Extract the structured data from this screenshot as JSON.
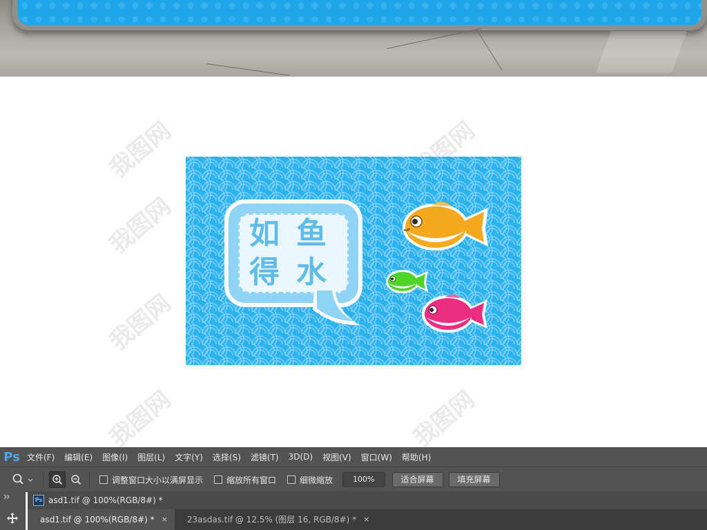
{
  "artwork": {
    "title_chars": [
      "如",
      "鱼",
      "得",
      "水"
    ],
    "colors": {
      "background": "#2db2ee",
      "bubble": "#8fd3f7",
      "title": "#5fbcea"
    },
    "fish": [
      {
        "name": "orange-fish",
        "color": "#f5a91e"
      },
      {
        "name": "green-fish",
        "color": "#4fd42a"
      },
      {
        "name": "pink-fish",
        "color": "#ec2d82"
      }
    ]
  },
  "watermark": "我图网",
  "menubar": {
    "logo": "Ps",
    "items": [
      "文件(F)",
      "编辑(E)",
      "图像(I)",
      "图层(L)",
      "文字(Y)",
      "选择(S)",
      "滤镜(T)",
      "3D(D)",
      "视图(V)",
      "窗口(W)",
      "帮助(H)"
    ]
  },
  "options": {
    "tool_icon": "zoom-icon",
    "checkbox_resize": "调整窗口大小以满屏显示",
    "checkbox_zoom_all": "缩放所有窗口",
    "checkbox_scrubby": "细微缩放",
    "zoom_value": "100%",
    "fit_screen": "适合屏幕",
    "fill_screen": "填充屏幕"
  },
  "panel_header": "asd1.tif @ 100%(RGB/8#) *",
  "tabs": [
    {
      "label": "asd1.tif @ 100%(RGB/8#) *",
      "active": true
    },
    {
      "label": "23asdas.tif @ 12.5% (图层 16, RGB/8#) *",
      "active": false
    }
  ],
  "close_glyph": "×"
}
